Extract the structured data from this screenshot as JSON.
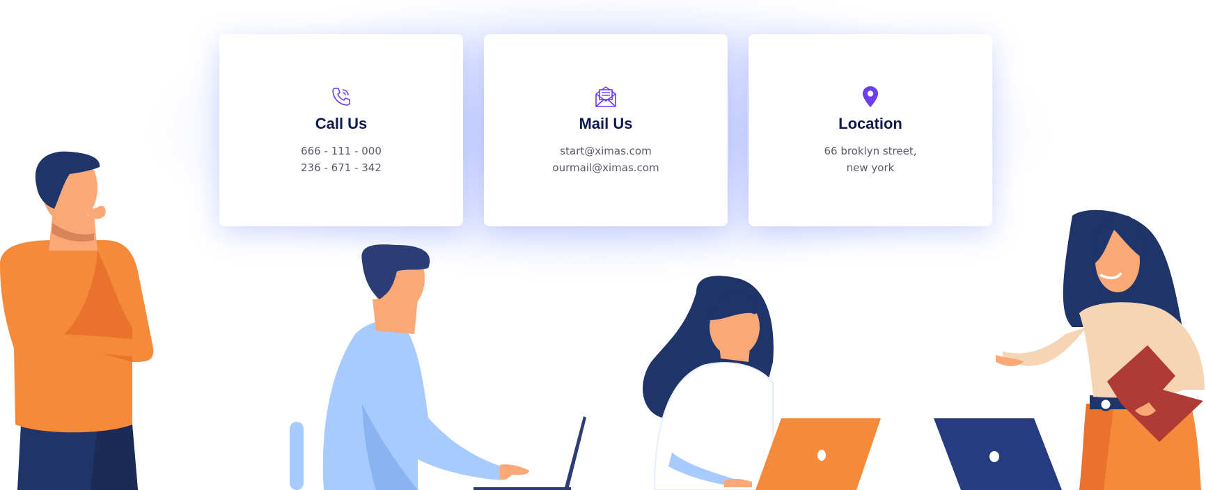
{
  "contact_cards": [
    {
      "icon": "phone-icon",
      "title": "Call Us",
      "lines": [
        "666 - 111 - 000",
        "236 - 671 - 342"
      ]
    },
    {
      "icon": "mail-icon",
      "title": "Mail Us",
      "lines": [
        "start@ximas.com",
        "ourmail@ximas.com"
      ]
    },
    {
      "icon": "location-pin-icon",
      "title": "Location",
      "lines": [
        "66 broklyn street,",
        "new york"
      ]
    }
  ],
  "colors": {
    "accent": "#6c3cf0",
    "title": "#0f1b4c",
    "text": "#5a5a6a",
    "glow": "#c5ceff",
    "orange": "#f58a3a",
    "navy": "#1f3468",
    "light_blue": "#a8cbff",
    "skin": "#f9a876"
  }
}
